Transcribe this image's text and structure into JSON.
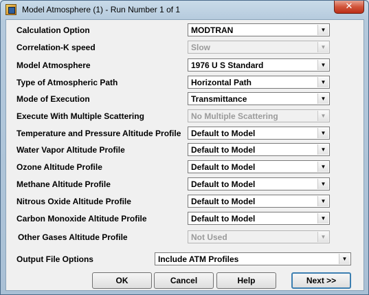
{
  "window": {
    "title": "Model Atmosphere (1) - Run Number  1 of  1",
    "close_glyph": "✕"
  },
  "fields": [
    {
      "label": "Calculation Option",
      "value": "MODTRAN",
      "disabled": false
    },
    {
      "label": "Correlation-K speed",
      "value": "Slow",
      "disabled": true
    },
    {
      "label": "Model Atmosphere",
      "value": "1976 U S Standard",
      "disabled": false
    },
    {
      "label": "Type of Atmospheric Path",
      "value": "Horizontal Path",
      "disabled": false
    },
    {
      "label": "Mode of Execution",
      "value": "Transmittance",
      "disabled": false
    },
    {
      "label": "Execute With Multiple Scattering",
      "value": "No Multiple Scattering",
      "disabled": true
    },
    {
      "label": "Temperature and Pressure Altitude Profile",
      "value": "Default to Model",
      "disabled": false
    },
    {
      "label": "Water Vapor Altitude Profile",
      "value": "Default to Model",
      "disabled": false
    },
    {
      "label": "Ozone Altitude Profile",
      "value": "Default to Model",
      "disabled": false
    },
    {
      "label": "Methane Altitude Profile",
      "value": "Default to Model",
      "disabled": false
    },
    {
      "label": "Nitrous Oxide Altitude Profile",
      "value": "Default to Model",
      "disabled": false
    },
    {
      "label": "Carbon Monoxide Altitude Profile",
      "value": "Default to Model",
      "disabled": false
    },
    {
      "label": "Other Gases Altitude Profile",
      "value": "Not Used",
      "disabled": true
    }
  ],
  "output": {
    "label": "Output File Options",
    "value": "Include ATM Profiles"
  },
  "buttons": {
    "ok": "OK",
    "cancel": "Cancel",
    "help": "Help",
    "next": "Next >>"
  },
  "icons": {
    "dropdown_arrow": "▼",
    "app": "app-icon"
  }
}
